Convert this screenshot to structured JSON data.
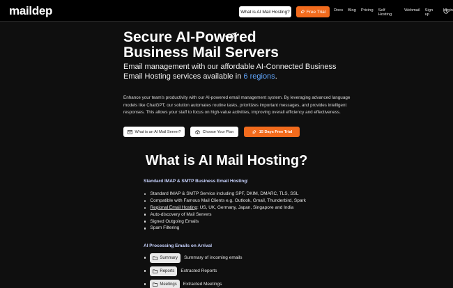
{
  "header": {
    "logo": "maildep",
    "what_button": "What is AI Mail Hosting?",
    "trial_button": "Free Trial",
    "nav": [
      "Docs",
      "Blog",
      "Pricing",
      "Self Hosting",
      "Webmail",
      "Sign up",
      "Login"
    ]
  },
  "hero": {
    "title_line1": "Secure AI-Powered",
    "title_line2": "Business Mail Servers",
    "subtitle_prefix": "Email management with our affordable AI-Connected Business Email Hosting services available in ",
    "subtitle_accent": "6 regions",
    "subtitle_suffix": ".",
    "description": "Enhance your team's productivity with our AI-powered email management system. By leveraging advanced language models like ChatGPT, our solution automates routine tasks, prioritizes important messages, and provides intelligent responses. This allows your staff to focus on high-value activities, improving overall efficiency and effectiveness.",
    "buttons": {
      "what": "What is an AI Mail Server?",
      "plan": "Choose Your Plan",
      "trial": "15 Days Free Trial"
    }
  },
  "section": {
    "title": "What is AI Mail Hosting?",
    "imap_heading": "Standard IMAP & SMTP Business Email Hosting:",
    "features": [
      "Standard IMAP & SMTP Service including SPF, DKIM, DMARC, TLS, SSL",
      "Compatible with Famous Mail Clients e.g. Outlook, Gmail, Thunderbird, Spark",
      "Auto-discovery of Mail Servers",
      "Signed Outgoing Emails",
      "Spam Filtering"
    ],
    "regional_link": "Regional Email Hosting",
    "regional_rest": ": US, UK, Germany, Japan, Singapore and India",
    "ai_heading": "AI Processing Emails on Arrival",
    "ai_items": [
      {
        "chip": "Summary",
        "text": "Summary of incoming emails"
      },
      {
        "chip": "Reports",
        "text": "Extracted Reports"
      },
      {
        "chip": "Meetings",
        "text": "Extracted Meetings"
      }
    ]
  },
  "colors": {
    "background": "#0f0f0f",
    "accent_orange": "#f26b1d",
    "accent_blue": "#60a5fa"
  }
}
